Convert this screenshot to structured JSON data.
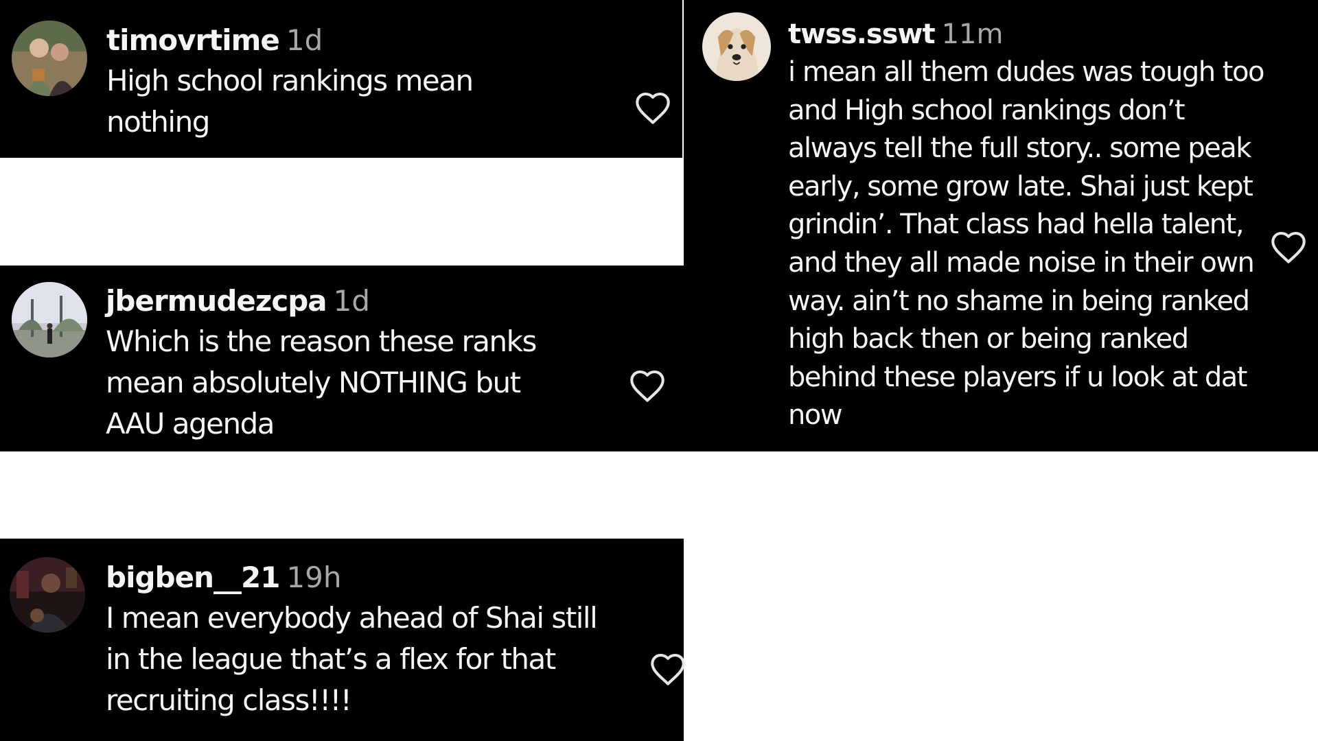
{
  "comments": [
    {
      "username": "timovrtime",
      "time": "1d",
      "text": "High school rankings mean nothing",
      "avatar_icon": "couple-photo-avatar",
      "like_icon": "heart-outline-icon"
    },
    {
      "username": "jbermudezcpa",
      "time": "1d",
      "text": "Which is the reason these ranks mean absolutely NOTHING but AAU agenda",
      "avatar_icon": "outdoor-photo-avatar",
      "like_icon": "heart-outline-icon"
    },
    {
      "username": "bigben__21",
      "time": "19h",
      "text": "I mean everybody ahead of Shai still in the league that’s a flex for that recruiting class!!!!",
      "avatar_icon": "dark-photo-avatar",
      "like_icon": "heart-outline-icon"
    },
    {
      "username": "twss.sswt",
      "time": "11m",
      "text": "i mean all them dudes was tough too and High school rankings don’t always tell the full story.. some peak early, some grow late. Shai just kept grindin’. That class had hella talent, and they all made noise in their own way. ain’t no shame in being ranked high back then or being ranked behind these players if u look at dat now",
      "avatar_icon": "dog-photo-avatar",
      "like_icon": "heart-outline-icon"
    }
  ],
  "colors": {
    "card_background": "#000000",
    "page_background": "#ffffff",
    "text": "#f5f5f5",
    "timestamp": "#a8a8a8"
  }
}
